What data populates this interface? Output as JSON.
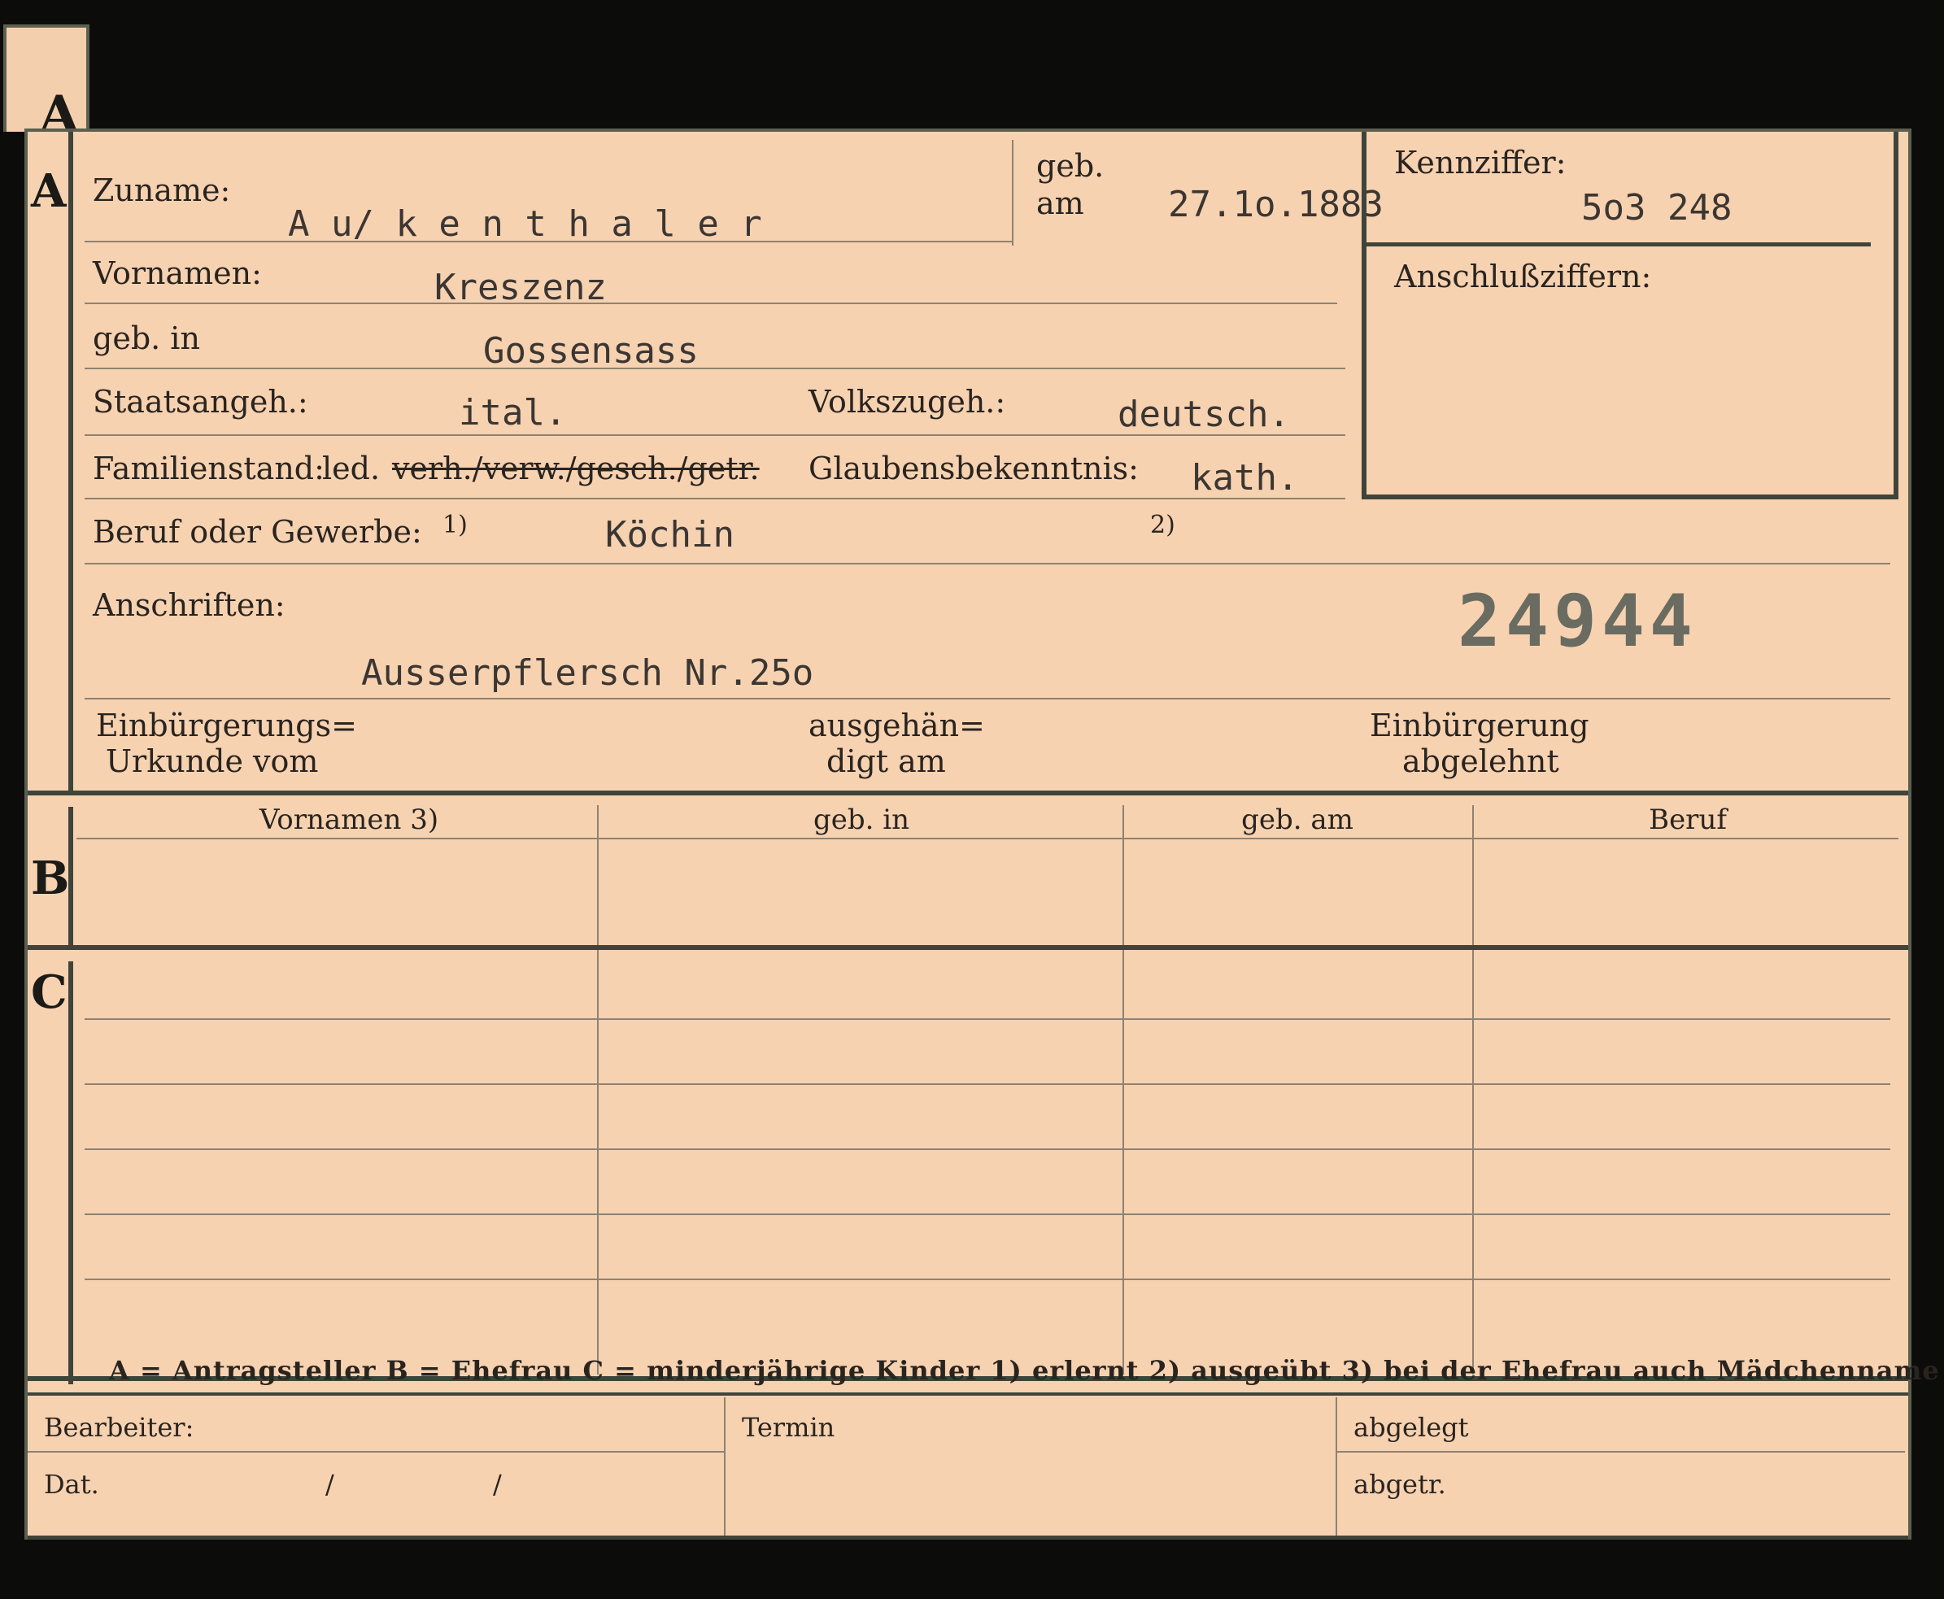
{
  "tab_letter": "A",
  "sections": {
    "a": "A",
    "b": "B",
    "c": "C"
  },
  "fields": {
    "zuname_label": "Zuname:",
    "zuname_value": "A u/ k e n t h a l e r",
    "geb_label": "geb.",
    "am_label": "am",
    "geb_am_value": "27.1o.1883",
    "kennziffer_label": "Kennziffer:",
    "kennziffer_value": "5o3 248",
    "anschlussziffern_label": "Anschlußziffern:",
    "vornamen_label": "Vornamen:",
    "vornamen_value": "Kreszenz",
    "geb_in_label": "geb. in",
    "geb_in_value": "Gossensass",
    "staatsangeh_label": "Staatsangeh.:",
    "staatsangeh_value": "ital.",
    "volkszugeh_label": "Volkszugeh.:",
    "volkszugeh_value": "deutsch.",
    "familienstand_label": "Familienstand:",
    "familienstand_led": "led.",
    "familienstand_struck": "verh./verw./gesch./getr.",
    "glaubensbekenntnis_label": "Glaubensbekenntnis:",
    "glaubensbekenntnis_value": "kath.",
    "beruf_label": "Beruf oder Gewerbe:",
    "beruf_note1": "1)",
    "beruf_value": "Köchin",
    "beruf_note2": "2)",
    "anschriften_label": "Anschriften:",
    "anschriften_value": "Ausserpflersch Nr.25o",
    "stamp_number": "24944",
    "einbuergerungs_label_1": "Einbürgerungs=",
    "einbuergerungs_label_2": "Urkunde vom",
    "ausgehaendigt_label_1": "ausgehän=",
    "ausgehaendigt_label_2": "digt am",
    "einbuergerung_label_1": "Einbürgerung",
    "einbuergerung_label_2": "abgelehnt"
  },
  "table": {
    "headers": [
      "Vornamen 3)",
      "geb. in",
      "geb. am",
      "Beruf"
    ]
  },
  "legend": "A = Antragsteller   B = Ehefrau   C = minderjährige Kinder   1) erlernt   2) ausgeübt   3) bei der Ehefrau auch Mädchenname",
  "footer": {
    "bearbeiter": "Bearbeiter:",
    "dat": "Dat.",
    "slash1": "/",
    "slash2": "/",
    "termin": "Termin",
    "abgelegt": "abgelegt",
    "abgetr": "abgetr."
  }
}
